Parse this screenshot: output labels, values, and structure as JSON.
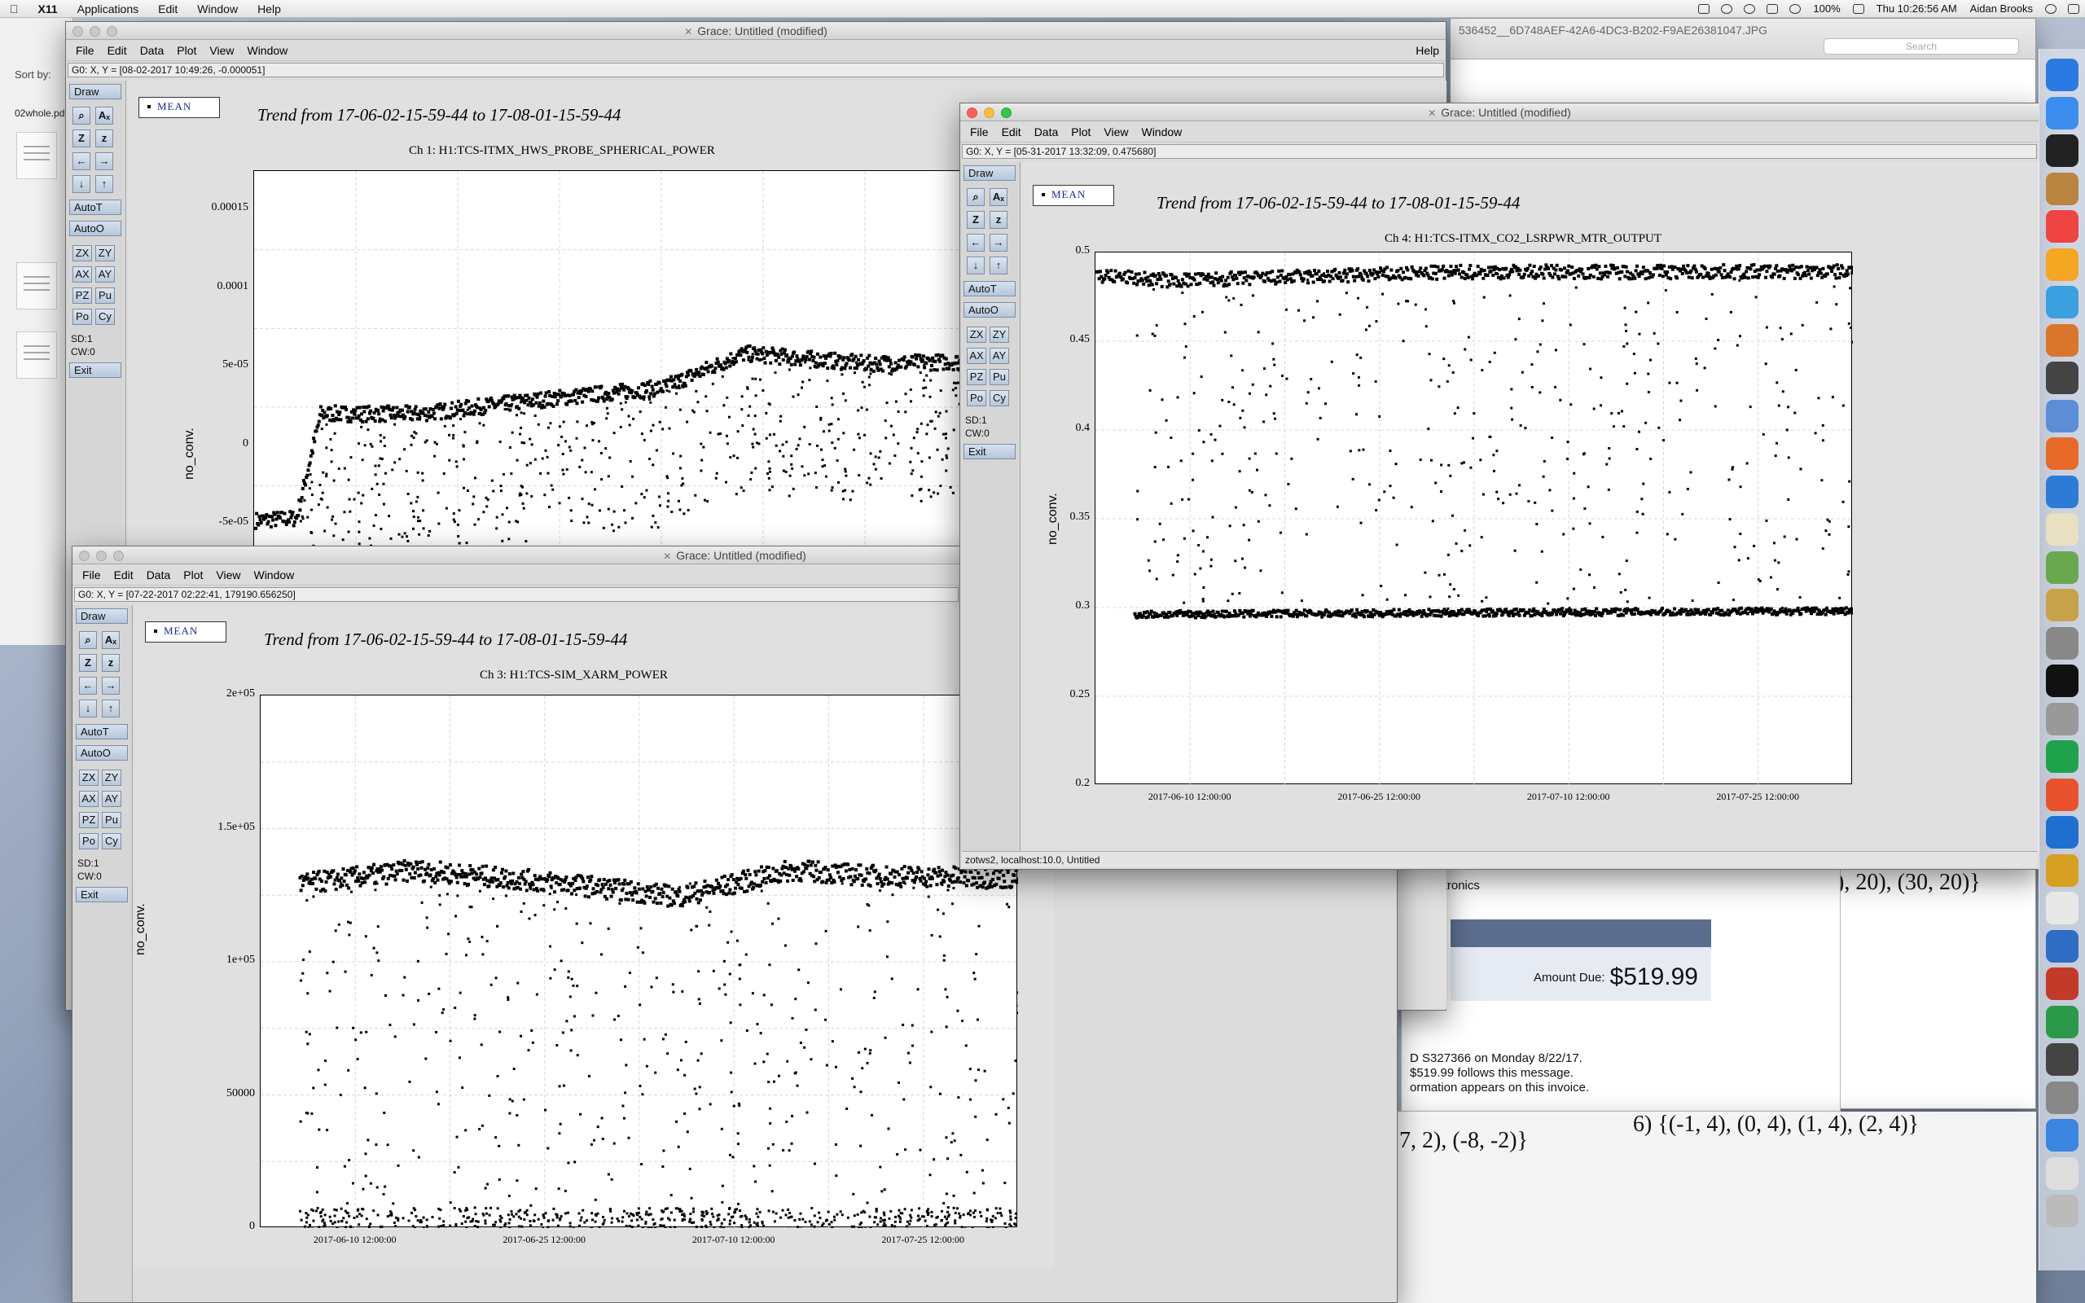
{
  "menubar": {
    "app": "X11",
    "items": [
      "Applications",
      "Edit",
      "Window",
      "Help"
    ],
    "battery": "100%",
    "clock": "Thu 10:26:56 AM",
    "user": "Aidan Brooks"
  },
  "background": {
    "finder": {
      "sort_label": "Sort by:",
      "file_name": "02whole.pd"
    },
    "preview": {
      "title": "536452__6D748AEF-42A6-4DC3-B202-F9AE26381047.JPG",
      "search": "Search"
    },
    "math": {
      "right_top": "), 20), (30, 20)}",
      "mid_left": "7, 2), (-8, -2)}",
      "mid_right": "6)  {(-1, 4), (0, 4), (1, 4), (2, 4)}"
    },
    "invoice": {
      "vendor": "n Electronics",
      "amount_label": "Amount Due:",
      "amount": "$519.99",
      "line1": "D S327366 on Monday 8/22/17.",
      "line2": "$519.99 follows this message.",
      "line3": "ormation appears on this invoice."
    }
  },
  "grace_menu": [
    "File",
    "Edit",
    "Data",
    "Plot",
    "View",
    "Window"
  ],
  "help": "Help",
  "tools": {
    "draw": "Draw",
    "autot": "AutoT",
    "autoo": "AutoO",
    "sd": "SD:1",
    "cw": "CW:0",
    "exit": "Exit",
    "zoom_icons": [
      "⌕",
      "Aₓ",
      "Z",
      "z",
      "←",
      "→",
      "↓",
      "↑"
    ],
    "pairs": [
      [
        "ZX",
        "ZY"
      ],
      [
        "AX",
        "AY"
      ],
      [
        "PZ",
        "Pu"
      ],
      [
        "Po",
        "Cy"
      ]
    ]
  },
  "win1": {
    "title": "Grace: Untitled (modified)",
    "status": "G0: X, Y = [08-02-2017 10:49:26, -0.000051]",
    "legend": "MEAN",
    "trend": "Trend from 17-06-02-15-59-44 to 17-08-01-15-59-44",
    "subtitle": "Ch 1: H1:TCS-ITMX_HWS_PROBE_SPHERICAL_POWER",
    "ylabel": "no_conv.",
    "yticks": [
      "0.00015",
      "0.0001",
      "5e-05",
      "0",
      "-5e-05"
    ]
  },
  "win3": {
    "title": "Grace: Untitled (modified)",
    "status": "G0: X, Y = [07-22-2017 02:22:41, 179190.656250]",
    "legend": "MEAN",
    "trend": "Trend from 17-06-02-15-59-44 to 17-08-01-15-59-44",
    "subtitle": "Ch 3: H1:TCS-SIM_XARM_POWER",
    "ylabel": "no_conv.",
    "yticks": [
      "2e+05",
      "1.5e+05",
      "1e+05",
      "50000",
      "0"
    ],
    "xticks": [
      "2017-06-10 12:00:00",
      "2017-06-25 12:00:00",
      "2017-07-10 12:00:00",
      "2017-07-25 12:00:00"
    ]
  },
  "win4": {
    "title": "Grace: Untitled (modified)",
    "status": "G0: X, Y = [05-31-2017 13:32:09, 0.475680]",
    "legend": "MEAN",
    "trend": "Trend from 17-06-02-15-59-44 to 17-08-01-15-59-44",
    "subtitle": "Ch 4: H1:TCS-ITMX_CO2_LSRPWR_MTR_OUTPUT",
    "ylabel": "no_conv.",
    "yticks": [
      "0.5",
      "0.45",
      "0.4",
      "0.35",
      "0.3",
      "0.25",
      "0.2"
    ],
    "xticks": [
      "2017-06-10 12:00:00",
      "2017-06-25 12:00:00",
      "2017-07-10 12:00:00",
      "2017-07-25 12:00:00"
    ],
    "footer": "zotws2, localhost:10.0, Untitled"
  },
  "chart_data": [
    {
      "type": "scatter",
      "title": "Trend from 17-06-02-15-59-44 to 17-08-01-15-59-44",
      "subtitle": "Ch 1: H1:TCS-ITMX_HWS_PROBE_SPHERICAL_POWER",
      "ylabel": "no_conv.",
      "ylim": [
        -6e-05,
        0.000175
      ],
      "trend_mean": [
        [
          0,
          2e-06
        ],
        [
          0.05,
          3e-06
        ],
        [
          0.08,
          5.5e-05
        ],
        [
          0.2,
          5.5e-05
        ],
        [
          0.35,
          6.2e-05
        ],
        [
          0.5,
          6.8e-05
        ],
        [
          0.6,
          8.5e-05
        ],
        [
          0.75,
          8e-05
        ],
        [
          1,
          8.2e-05
        ]
      ]
    },
    {
      "type": "scatter",
      "title": "Trend from 17-06-02-15-59-44 to 17-08-01-15-59-44",
      "subtitle": "Ch 3: H1:TCS-SIM_XARM_POWER",
      "ylabel": "no_conv.",
      "ylim": [
        0,
        200000
      ],
      "xticks": [
        "2017-06-10 12:00:00",
        "2017-06-25 12:00:00",
        "2017-07-10 12:00:00",
        "2017-07-25 12:00:00"
      ],
      "trend_mean": [
        [
          0,
          128000
        ],
        [
          0.2,
          135000
        ],
        [
          0.4,
          130000
        ],
        [
          0.55,
          125000
        ],
        [
          0.7,
          135000
        ],
        [
          0.8,
          133000
        ],
        [
          1,
          132000
        ]
      ]
    },
    {
      "type": "scatter",
      "title": "Trend from 17-06-02-15-59-44 to 17-08-01-15-59-44",
      "subtitle": "Ch 4: H1:TCS-ITMX_CO2_LSRPWR_MTR_OUTPUT",
      "ylabel": "no_conv.",
      "ylim": [
        0.2,
        0.5
      ],
      "xticks": [
        "2017-06-10 12:00:00",
        "2017-06-25 12:00:00",
        "2017-07-10 12:00:00",
        "2017-07-25 12:00:00"
      ],
      "trend_upper": [
        [
          0,
          0.488
        ],
        [
          0.1,
          0.485
        ],
        [
          0.5,
          0.49
        ],
        [
          1,
          0.49
        ]
      ],
      "trend_lower": [
        [
          0.05,
          0.297
        ],
        [
          0.5,
          0.298
        ],
        [
          1,
          0.299
        ]
      ]
    }
  ]
}
